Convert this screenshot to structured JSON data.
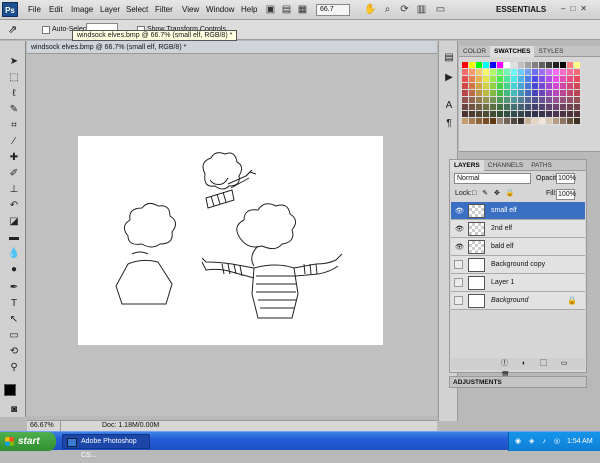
{
  "app": {
    "logo": "Ps"
  },
  "menus": [
    "File",
    "Edit",
    "Image",
    "Layer",
    "Select",
    "Filter",
    "View",
    "Window",
    "Help"
  ],
  "toolbar": {
    "zoom": "66.7",
    "workspace": "ESSENTIALS",
    "window_controls": "–□✕"
  },
  "options": {
    "move_icon": "move-tool-icon",
    "auto_select_label": "Auto-Select:",
    "show_transform_label": "Show Transform Controls"
  },
  "tooltip": "windsock elves.bmp @ 66.7% (small elf, RGB/8) *",
  "document": {
    "tab_title": "windsock elves.bmp @ 66.7% (small elf, RGB/8) *",
    "zoom_status": "66.67%",
    "doc_info": "Doc: 1.18M/0.00M"
  },
  "color_panel": {
    "tabs": [
      "COLOR",
      "SWATCHES",
      "STYLES"
    ],
    "active_tab": "SWATCHES"
  },
  "layers_panel": {
    "tabs": [
      "LAYERS",
      "CHANNELS",
      "PATHS"
    ],
    "blend_mode": "Normal",
    "opacity_label": "Opacity:",
    "opacity": "100%",
    "lock_label": "Lock:",
    "fill_label": "Fill:",
    "fill": "100%",
    "layers": [
      {
        "name": "small elf",
        "visible": true,
        "selected": true
      },
      {
        "name": "2nd elf",
        "visible": true,
        "selected": false
      },
      {
        "name": "bald elf",
        "visible": true,
        "selected": false
      },
      {
        "name": "Background copy",
        "visible": false,
        "selected": false
      },
      {
        "name": "Layer 1",
        "visible": false,
        "selected": false
      },
      {
        "name": "Background",
        "visible": false,
        "selected": false,
        "locked": true
      }
    ]
  },
  "adjustments": {
    "title": "ADJUSTMENTS"
  },
  "taskbar": {
    "start_label": "start",
    "task_label": "Adobe Photoshop CS...",
    "clock": "1:54 AM"
  }
}
